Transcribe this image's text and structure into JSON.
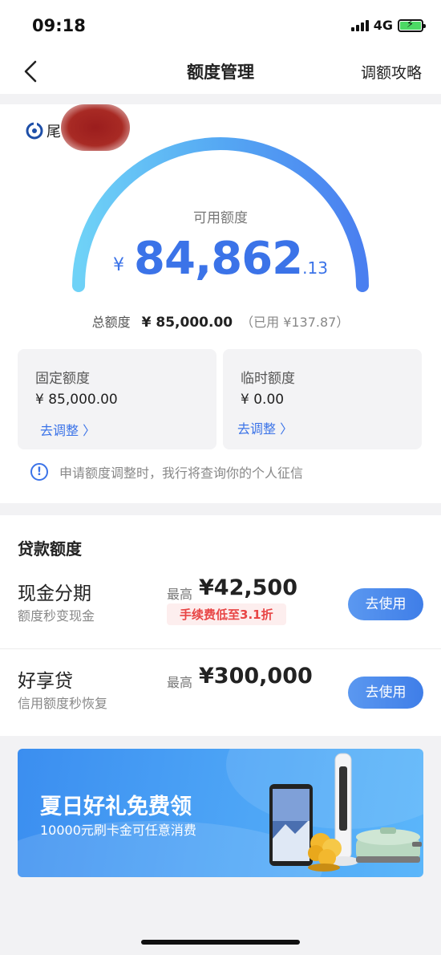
{
  "status_bar": {
    "time": "09:18",
    "network": "4G"
  },
  "nav": {
    "title": "额度管理",
    "action": "调额攻略"
  },
  "bank": {
    "name": "尾"
  },
  "quota": {
    "available_label": "可用额度",
    "currency": "¥",
    "available_int": "84,862",
    "available_dec": ".13",
    "total_label": "总额度",
    "total_value": "¥ 85,000.00",
    "used_text": "（已用 ¥137.87）"
  },
  "fixed": {
    "label": "固定额度",
    "value": "¥ 85,000.00",
    "adjust": "去调整 〉"
  },
  "temp": {
    "label": "临时额度",
    "value": "¥ 0.00",
    "adjust": "去调整 〉"
  },
  "notice": "申请额度调整时，我行将查询你的个人征信",
  "loans": {
    "title": "贷款额度",
    "items": [
      {
        "name": "现金分期",
        "sub": "额度秒变现金",
        "max_label": "最高",
        "max_value": "¥42,500",
        "tag": "手续费低至3.1折",
        "button": "去使用"
      },
      {
        "name": "好享贷",
        "sub": "信用额度秒恢复",
        "max_label": "最高",
        "max_value": "¥300,000",
        "button": "去使用"
      }
    ]
  },
  "banner": {
    "title": "夏日好礼免费领",
    "subtitle": "10000元刷卡金可任意消费"
  },
  "colors": {
    "accent": "#3b73e8",
    "tag_red": "#e84545",
    "banner": "#4aa1f5"
  }
}
